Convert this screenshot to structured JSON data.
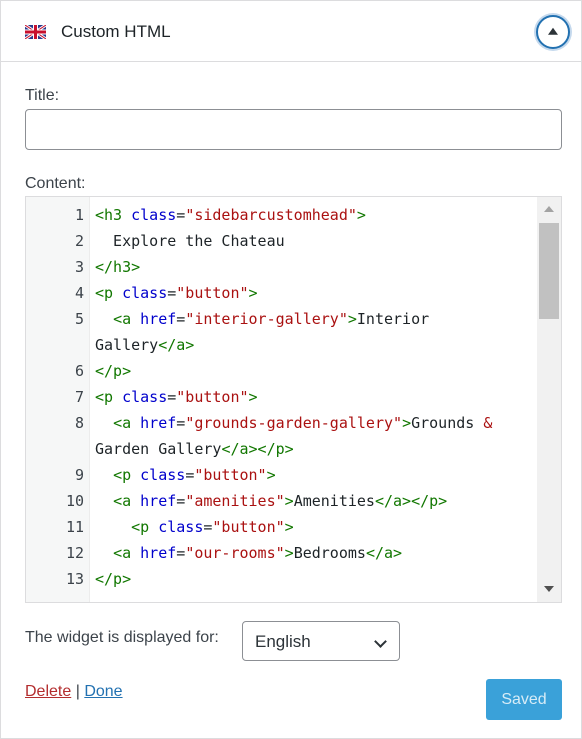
{
  "widget": {
    "title": "Custom HTML",
    "toggle_icon": "collapse-up-icon",
    "flag_icon": "uk-flag-icon"
  },
  "form": {
    "title_label": "Title:",
    "title_value": "",
    "content_label": "Content:",
    "display_label": "The widget is displayed for:",
    "language_selected": "English"
  },
  "code": {
    "lines": [
      {
        "n": "1",
        "segs": [
          [
            "tag",
            "<h3 "
          ],
          [
            "attr",
            "class"
          ],
          [
            "plain",
            "="
          ],
          [
            "str",
            "\"sidebarcustomhead\""
          ],
          [
            "tag",
            ">"
          ]
        ]
      },
      {
        "n": "2",
        "segs": [
          [
            "plain",
            "  Explore the Chateau"
          ]
        ]
      },
      {
        "n": "3",
        "segs": [
          [
            "tag",
            "</h3>"
          ]
        ]
      },
      {
        "n": "4",
        "segs": [
          [
            "tag",
            "<p "
          ],
          [
            "attr",
            "class"
          ],
          [
            "plain",
            "="
          ],
          [
            "str",
            "\"button\""
          ],
          [
            "tag",
            ">"
          ]
        ]
      },
      {
        "n": "5",
        "segs": [
          [
            "plain",
            "  "
          ],
          [
            "tag",
            "<a "
          ],
          [
            "attr",
            "href"
          ],
          [
            "plain",
            "="
          ],
          [
            "str",
            "\"interior-gallery\""
          ],
          [
            "tag",
            ">"
          ],
          [
            "plain",
            "Interior"
          ]
        ]
      },
      {
        "n": "",
        "segs": [
          [
            "plain",
            "Gallery"
          ],
          [
            "tag",
            "</a>"
          ]
        ]
      },
      {
        "n": "6",
        "segs": [
          [
            "tag",
            "</p>"
          ]
        ]
      },
      {
        "n": "7",
        "segs": [
          [
            "tag",
            "<p "
          ],
          [
            "attr",
            "class"
          ],
          [
            "plain",
            "="
          ],
          [
            "str",
            "\"button\""
          ],
          [
            "tag",
            ">"
          ]
        ]
      },
      {
        "n": "8",
        "segs": [
          [
            "plain",
            "  "
          ],
          [
            "tag",
            "<a "
          ],
          [
            "attr",
            "href"
          ],
          [
            "plain",
            "="
          ],
          [
            "str",
            "\"grounds-garden-gallery\""
          ],
          [
            "tag",
            ">"
          ],
          [
            "plain",
            "Grounds "
          ],
          [
            "amp",
            "&"
          ]
        ]
      },
      {
        "n": "",
        "segs": [
          [
            "plain",
            "Garden Gallery"
          ],
          [
            "tag",
            "</a></p>"
          ]
        ]
      },
      {
        "n": "9",
        "segs": [
          [
            "plain",
            "  "
          ],
          [
            "tag",
            "<p "
          ],
          [
            "attr",
            "class"
          ],
          [
            "plain",
            "="
          ],
          [
            "str",
            "\"button\""
          ],
          [
            "tag",
            ">"
          ]
        ]
      },
      {
        "n": "10",
        "segs": [
          [
            "plain",
            "  "
          ],
          [
            "tag",
            "<a "
          ],
          [
            "attr",
            "href"
          ],
          [
            "plain",
            "="
          ],
          [
            "str",
            "\"amenities\""
          ],
          [
            "tag",
            ">"
          ],
          [
            "plain",
            "Amenities"
          ],
          [
            "tag",
            "</a></p>"
          ]
        ]
      },
      {
        "n": "11",
        "segs": [
          [
            "plain",
            "    "
          ],
          [
            "tag",
            "<p "
          ],
          [
            "attr",
            "class"
          ],
          [
            "plain",
            "="
          ],
          [
            "str",
            "\"button\""
          ],
          [
            "tag",
            ">"
          ]
        ]
      },
      {
        "n": "12",
        "segs": [
          [
            "plain",
            "  "
          ],
          [
            "tag",
            "<a "
          ],
          [
            "attr",
            "href"
          ],
          [
            "plain",
            "="
          ],
          [
            "str",
            "\"our-rooms\""
          ],
          [
            "tag",
            ">"
          ],
          [
            "plain",
            "Bedrooms"
          ],
          [
            "tag",
            "</a>"
          ]
        ]
      },
      {
        "n": "13",
        "segs": [
          [
            "tag",
            "</p>"
          ]
        ]
      }
    ]
  },
  "actions": {
    "delete_label": "Delete",
    "separator": "|",
    "done_label": "Done",
    "saved_label": "Saved"
  },
  "colors": {
    "accent": "#2271b1",
    "saved_button": "#3aa1d9",
    "delete_link": "#b32d2e",
    "code_tag": "#117700",
    "code_attr": "#0000cc",
    "code_string": "#aa1111"
  }
}
